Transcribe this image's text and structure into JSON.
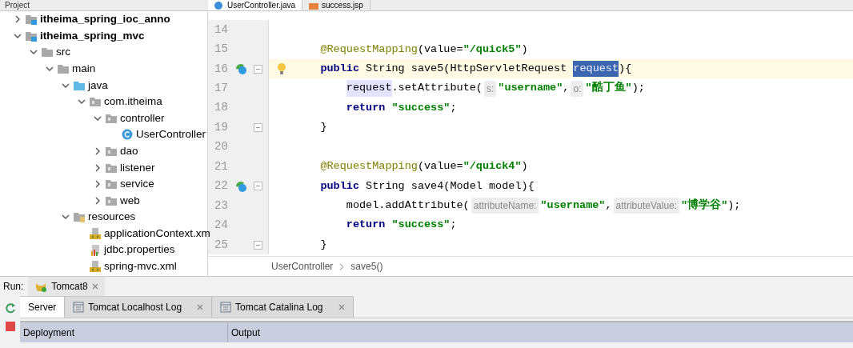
{
  "project_panel": {
    "title": "Project"
  },
  "editor_tabs": [
    {
      "label": "UserController.java",
      "kind": "java",
      "selected": true
    },
    {
      "label": "success.jsp",
      "kind": "jsp",
      "selected": false
    }
  ],
  "tree": [
    {
      "label": "itheima_spring_ioc_anno",
      "kind": "module",
      "expanded": false
    },
    {
      "label": "itheima_spring_mvc",
      "kind": "module",
      "expanded": true,
      "children": [
        {
          "label": "src",
          "kind": "folder",
          "expanded": true,
          "children": [
            {
              "label": "main",
              "kind": "folder",
              "expanded": true,
              "children": [
                {
                  "label": "java",
                  "kind": "source",
                  "expanded": true,
                  "children": [
                    {
                      "label": "com.itheima",
                      "kind": "package",
                      "expanded": true,
                      "children": [
                        {
                          "label": "controller",
                          "kind": "package",
                          "expanded": true,
                          "children": [
                            {
                              "label": "UserController",
                              "kind": "class"
                            }
                          ]
                        },
                        {
                          "label": "dao",
                          "kind": "package",
                          "expanded": false
                        },
                        {
                          "label": "listener",
                          "kind": "package",
                          "expanded": false
                        },
                        {
                          "label": "service",
                          "kind": "package",
                          "expanded": false
                        },
                        {
                          "label": "web",
                          "kind": "package",
                          "expanded": false
                        }
                      ]
                    }
                  ]
                },
                {
                  "label": "resources",
                  "kind": "resources",
                  "expanded": true,
                  "children": [
                    {
                      "label": "applicationContext.xm",
                      "kind": "xml"
                    },
                    {
                      "label": "jdbc.properties",
                      "kind": "properties"
                    },
                    {
                      "label": "spring-mvc.xml",
                      "kind": "xml"
                    }
                  ]
                }
              ]
            }
          ]
        }
      ]
    }
  ],
  "code_lines": [
    {
      "number": "14",
      "current": false,
      "bean": false,
      "bulb": false,
      "fold": false
    },
    {
      "number": "15",
      "kind": "member",
      "current": false,
      "bean": false,
      "bulb": false,
      "fold": false,
      "tokens": [
        {
          "kind": "annotation",
          "text": "@RequestMapping"
        },
        {
          "kind": "plain",
          "text": "(value="
        },
        {
          "kind": "string",
          "text": "\"/quick5\""
        },
        {
          "kind": "plain",
          "text": ")"
        }
      ]
    },
    {
      "number": "16",
      "kind": "member",
      "current": true,
      "bean": true,
      "bulb": true,
      "fold": true,
      "tokens": [
        {
          "kind": "keyword",
          "text": "public"
        },
        {
          "kind": "plain",
          "text": "String save5(HttpServletRequest "
        },
        {
          "kind": "selected",
          "text": "request"
        },
        {
          "kind": "plain",
          "text": "){"
        }
      ]
    },
    {
      "number": "17",
      "kind": "statement",
      "current": false,
      "bean": false,
      "bulb": false,
      "fold": false,
      "tokens": [
        {
          "kind": "usage",
          "text": "request"
        },
        {
          "kind": "plain",
          "text": ".setAttribute("
        },
        {
          "kind": "hint",
          "text": "s:"
        },
        {
          "kind": "string",
          "text": "\"username\""
        },
        {
          "kind": "plain",
          "text": ","
        },
        {
          "kind": "hint",
          "text": "o:"
        },
        {
          "kind": "string",
          "text": "\"酷丁鱼\""
        },
        {
          "kind": "plain",
          "text": ");"
        }
      ]
    },
    {
      "number": "18",
      "kind": "statement",
      "current": false,
      "bean": false,
      "bulb": false,
      "fold": false,
      "tokens": [
        {
          "kind": "keyword",
          "text": "return"
        },
        {
          "kind": "string",
          "text": "\"success\""
        },
        {
          "kind": "plain",
          "text": ";"
        }
      ]
    },
    {
      "number": "19",
      "kind": "member",
      "current": false,
      "bean": false,
      "bulb": false,
      "fold": true,
      "tokens": [
        {
          "kind": "plain",
          "text": "}"
        }
      ]
    },
    {
      "number": "20",
      "current": false,
      "bean": false,
      "bulb": false,
      "fold": false
    },
    {
      "number": "21",
      "kind": "member",
      "current": false,
      "bean": false,
      "bulb": false,
      "fold": false,
      "tokens": [
        {
          "kind": "annotation",
          "text": "@RequestMapping"
        },
        {
          "kind": "plain",
          "text": "(value="
        },
        {
          "kind": "string",
          "text": "\"/quick4\""
        },
        {
          "kind": "plain",
          "text": ")"
        }
      ]
    },
    {
      "number": "22",
      "kind": "member",
      "current": false,
      "bean": true,
      "bulb": false,
      "fold": true,
      "tokens": [
        {
          "kind": "keyword",
          "text": "public"
        },
        {
          "kind": "plain",
          "text": "String save4(Model model){"
        }
      ]
    },
    {
      "number": "23",
      "kind": "statement",
      "current": false,
      "bean": false,
      "bulb": false,
      "fold": false,
      "tokens": [
        {
          "kind": "plain",
          "text": "model.addAttribute("
        },
        {
          "kind": "hint",
          "text": "attributeName:"
        },
        {
          "kind": "string",
          "text": "\"username\""
        },
        {
          "kind": "plain",
          "text": ","
        },
        {
          "kind": "hint",
          "text": "attributeValue:"
        },
        {
          "kind": "string",
          "text": "\"博学谷\""
        },
        {
          "kind": "plain",
          "text": ");"
        }
      ]
    },
    {
      "number": "24",
      "kind": "statement",
      "current": false,
      "bean": false,
      "bulb": false,
      "fold": false,
      "tokens": [
        {
          "kind": "keyword",
          "text": "return"
        },
        {
          "kind": "string",
          "text": "\"success\""
        },
        {
          "kind": "plain",
          "text": ";"
        }
      ]
    },
    {
      "number": "25",
      "kind": "member",
      "current": false,
      "bean": false,
      "bulb": false,
      "fold": true,
      "tokens": [
        {
          "kind": "plain",
          "text": "}"
        }
      ]
    }
  ],
  "breadcrumb": [
    "UserController",
    "save5()"
  ],
  "run_bar": {
    "label": "Run:",
    "config": "Tomcat8"
  },
  "run_tabs": [
    {
      "label": "Server",
      "selected": true,
      "closable": false
    },
    {
      "label": "Tomcat Localhost Log",
      "selected": false,
      "closable": true
    },
    {
      "label": "Tomcat Catalina Log",
      "selected": false,
      "closable": true
    }
  ],
  "table": {
    "columns": [
      "Deployment",
      "Output"
    ]
  }
}
